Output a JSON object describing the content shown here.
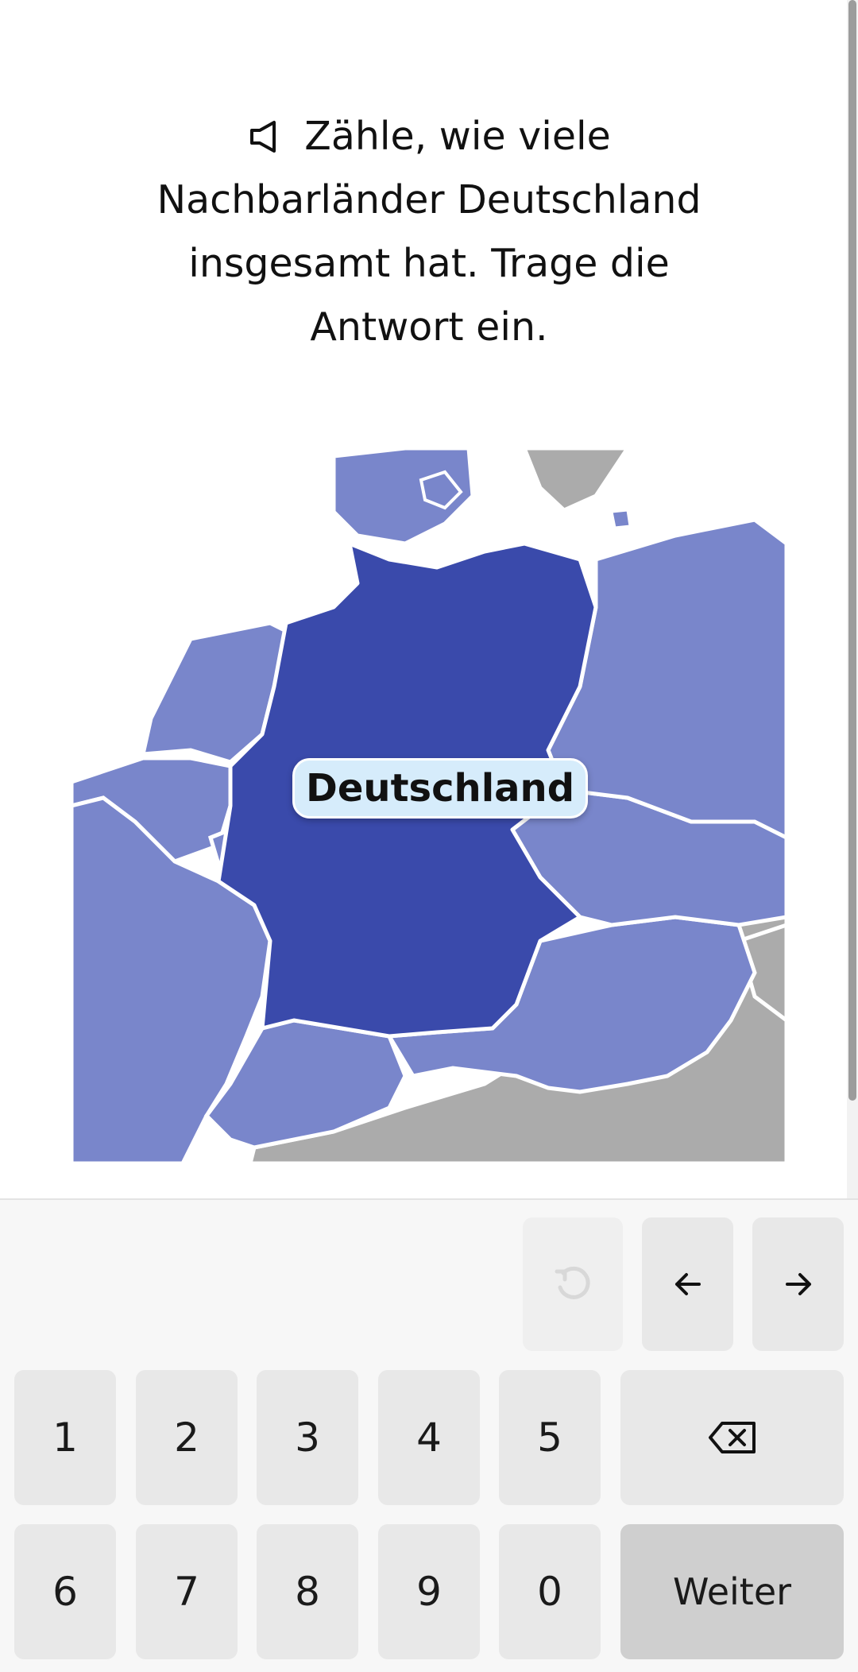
{
  "question": {
    "speaker_icon": "speaker-icon",
    "text": "Zähle, wie viele Nachbarländer Deutschland insgesamt hat. Trage die Antwort ein."
  },
  "map": {
    "label": "Deutschland",
    "colors": {
      "germany": "#3a4aab",
      "neighbors": "#7986cb",
      "other": "#ababab",
      "borders": "#ffffff"
    }
  },
  "keyboard": {
    "nav": {
      "undo_icon": "undo-icon",
      "left_icon": "arrow-left-icon",
      "right_icon": "arrow-right-icon"
    },
    "digits_row1": [
      "1",
      "2",
      "3",
      "4",
      "5"
    ],
    "digits_row2": [
      "6",
      "7",
      "8",
      "9",
      "0"
    ],
    "backspace_icon": "backspace-icon",
    "submit_label": "Weiter"
  }
}
